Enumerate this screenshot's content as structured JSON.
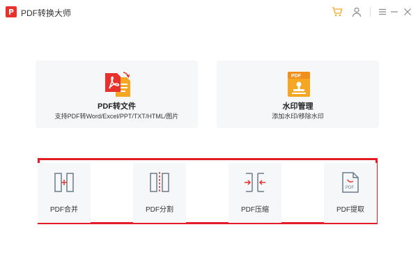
{
  "window": {
    "title": "PDF转换大师"
  },
  "cards": [
    {
      "title": "PDF转文件",
      "desc": "支持PDF转Word/Excel/PPT/TXT/HTML/图片",
      "icon": "pdf-convert-icon"
    },
    {
      "title": "水印管理",
      "desc": "添加水印/移除水印",
      "icon": "watermark-icon"
    }
  ],
  "tools": [
    {
      "label": "PDF合并",
      "icon": "merge-icon"
    },
    {
      "label": "PDF分割",
      "icon": "split-icon"
    },
    {
      "label": "PDF压缩",
      "icon": "compress-icon"
    },
    {
      "label": "PDF提取",
      "icon": "extract-icon"
    }
  ],
  "colors": {
    "brand": "#e8312c",
    "highlight_frame": "#e21c24",
    "icon_gray": "#6b7a8a",
    "accent_orange": "#f5a623"
  }
}
